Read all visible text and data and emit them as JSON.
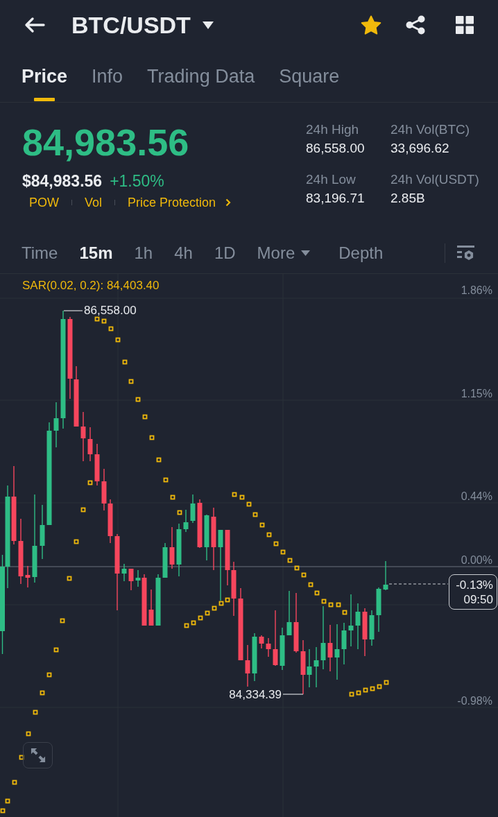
{
  "header": {
    "pair": "BTC/USDT",
    "favorite": true
  },
  "tabs": [
    {
      "label": "Price",
      "selected": true
    },
    {
      "label": "Info",
      "selected": false
    },
    {
      "label": "Trading Data",
      "selected": false
    },
    {
      "label": "Square",
      "selected": false
    }
  ],
  "ticker": {
    "last_price": "84,983.56",
    "usd_price": "$84,983.56",
    "change": "+1.50%",
    "tags": [
      {
        "label": "POW",
        "kind": "tag"
      },
      {
        "label": "Vol",
        "kind": "tag"
      },
      {
        "label": "Price Protection",
        "kind": "link"
      }
    ]
  },
  "stats": [
    {
      "label": "24h High",
      "value": "86,558.00"
    },
    {
      "label": "24h Vol(BTC)",
      "value": "33,696.62"
    },
    {
      "label": "24h Low",
      "value": "83,196.71"
    },
    {
      "label": "24h Vol(USDT)",
      "value": "2.85B"
    }
  ],
  "intervals": [
    {
      "label": "Time",
      "kind": "interval",
      "selected": false
    },
    {
      "label": "15m",
      "kind": "interval",
      "selected": true
    },
    {
      "label": "1h",
      "kind": "interval",
      "selected": false
    },
    {
      "label": "4h",
      "kind": "interval",
      "selected": false
    },
    {
      "label": "1D",
      "kind": "interval",
      "selected": false
    },
    {
      "label": "More",
      "kind": "menu",
      "selected": false
    },
    {
      "label": "Depth",
      "kind": "view",
      "selected": false
    }
  ],
  "chart": {
    "indicator": "SAR(0.02, 0.2): 84,403.40",
    "axis_labels": [
      "1.86%",
      "1.15%",
      "0.44%",
      "0.00%",
      "-0.98%"
    ],
    "high_label": "86,558.00",
    "low_label": "84,334.39",
    "price_tag": {
      "change": "-0.13%",
      "countdown": "09:50"
    }
  }
}
